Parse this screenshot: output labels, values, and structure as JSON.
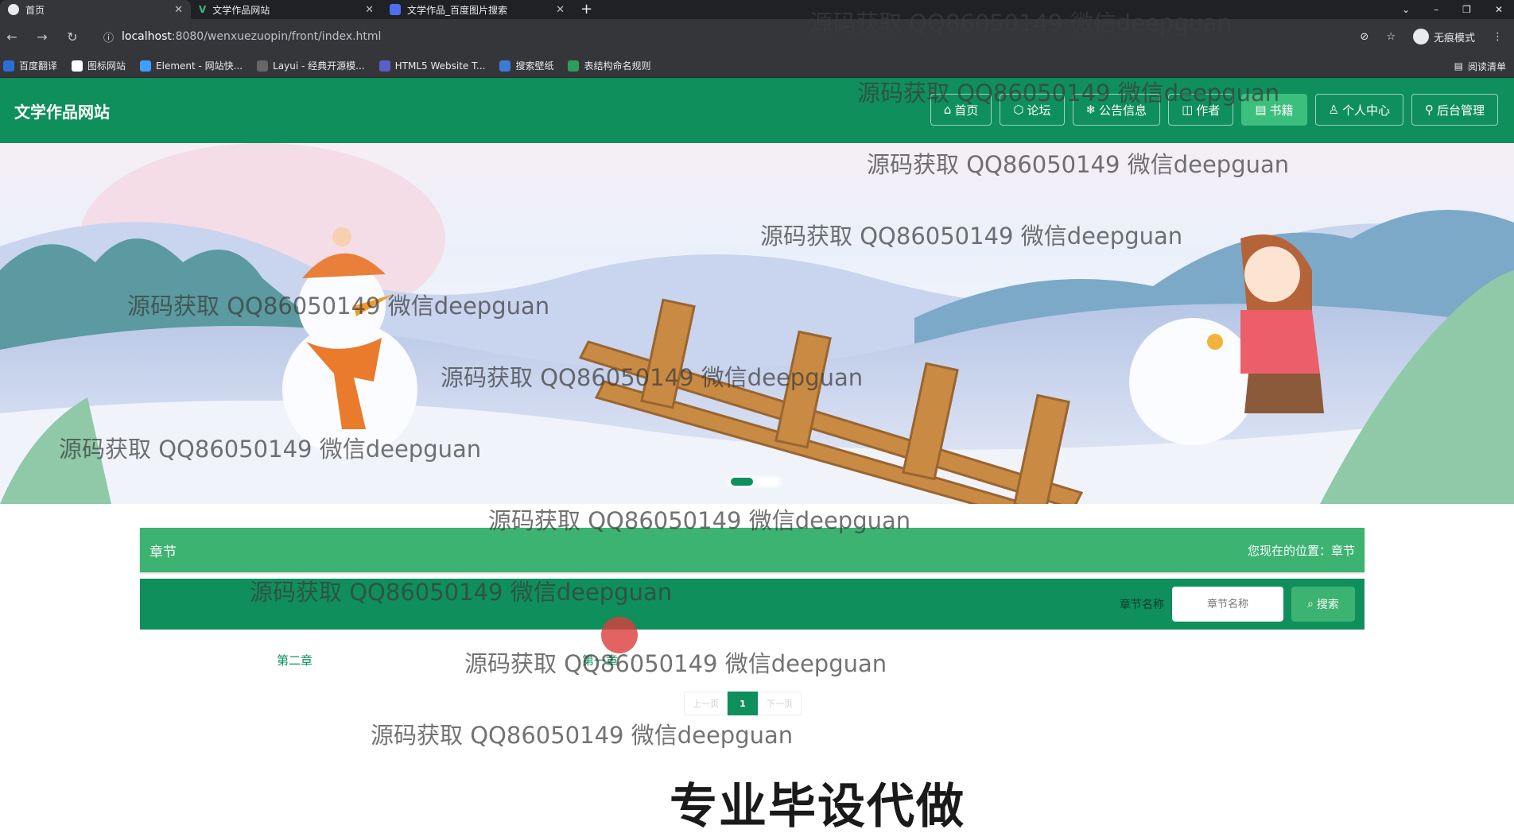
{
  "browser": {
    "tabs": [
      {
        "title": "首页",
        "active": true
      },
      {
        "title": "文学作品网站",
        "active": false
      },
      {
        "title": "文学作品_百度图片搜索",
        "active": false
      }
    ],
    "url_domain": "localhost",
    "url_path": ":8080/wenxuezuopin/front/index.html",
    "profile_label": "无痕模式",
    "reading_list": "阅读清单",
    "bookmarks": [
      "百度翻译",
      "图标网站",
      "Element - 网站快...",
      "Layui - 经典开源模...",
      "HTML5 Website T...",
      "搜索壁纸",
      "表结构命名规则"
    ]
  },
  "site": {
    "title": "文学作品网站",
    "menu": [
      {
        "label": "首页",
        "icon": "home-icon"
      },
      {
        "label": "论坛",
        "icon": "cube-icon"
      },
      {
        "label": "公告信息",
        "icon": "snowflake-icon"
      },
      {
        "label": "作者",
        "icon": "book-open-icon"
      },
      {
        "label": "书籍",
        "icon": "book-icon"
      },
      {
        "label": "个人中心",
        "icon": "user-icon"
      },
      {
        "label": "后台管理",
        "icon": "link-icon"
      }
    ],
    "active_menu": "书籍"
  },
  "breadcrumb": {
    "title": "章节",
    "location": "您现在的位置：章节"
  },
  "search": {
    "label": "章节名称",
    "placeholder": "章节名称",
    "button": "搜索"
  },
  "chapters": [
    "第二章",
    "第一章"
  ],
  "pagination": {
    "prev": "上一页",
    "current": "1",
    "next": "下一页"
  },
  "overlay_text": "专业毕设代做",
  "watermark": "源码获取 QQ86050149 微信deepguan",
  "colors": {
    "primary": "#0f8f5c",
    "accent": "#3cb371"
  }
}
